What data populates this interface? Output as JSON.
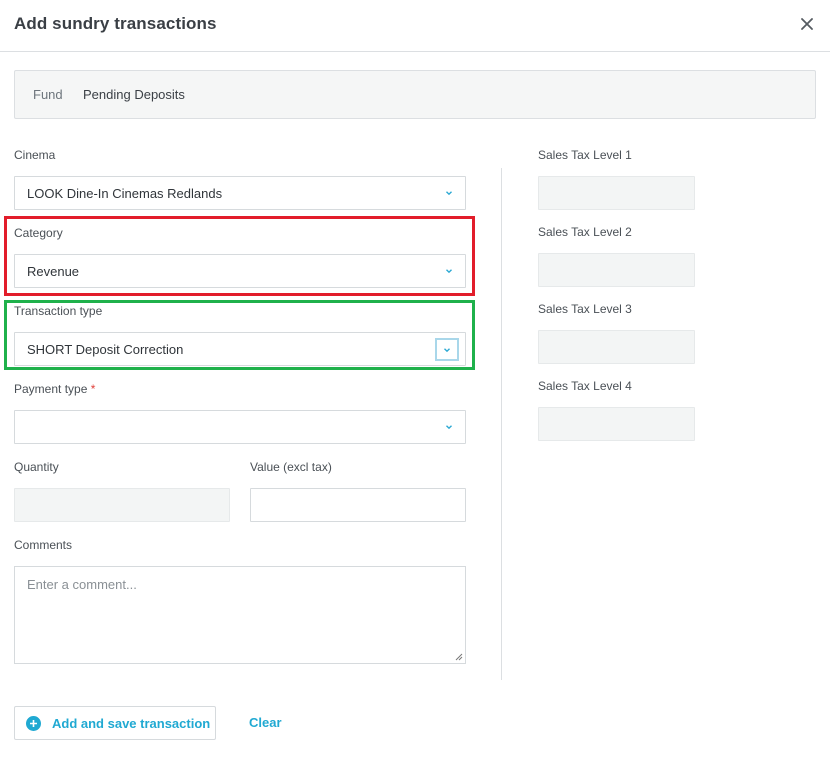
{
  "dialog": {
    "title": "Add sundry transactions",
    "close_icon": "close-icon"
  },
  "fund": {
    "label": "Fund",
    "value": "Pending Deposits"
  },
  "form": {
    "cinema": {
      "label": "Cinema",
      "value": "LOOK Dine-In Cinemas Redlands"
    },
    "category": {
      "label": "Category",
      "value": "Revenue"
    },
    "transaction_type": {
      "label": "Transaction type",
      "value": "SHORT Deposit Correction"
    },
    "payment_type": {
      "label": "Payment type",
      "required_mark": "*",
      "value": ""
    },
    "quantity": {
      "label": "Quantity",
      "value": ""
    },
    "value_excl_tax": {
      "label": "Value (excl tax)",
      "value": ""
    },
    "comments": {
      "label": "Comments",
      "placeholder": "Enter a comment..."
    }
  },
  "sales_tax": {
    "levels": [
      {
        "label": "Sales Tax Level 1",
        "value": ""
      },
      {
        "label": "Sales Tax Level 2",
        "value": ""
      },
      {
        "label": "Sales Tax Level 3",
        "value": ""
      },
      {
        "label": "Sales Tax Level 4",
        "value": ""
      }
    ]
  },
  "actions": {
    "add_save_label": "Add and save transaction",
    "clear_label": "Clear"
  },
  "colors": {
    "accent": "#20a9d2",
    "highlight_red": "#e21d2a",
    "highlight_green": "#1fb14b",
    "required": "#e0403a"
  }
}
